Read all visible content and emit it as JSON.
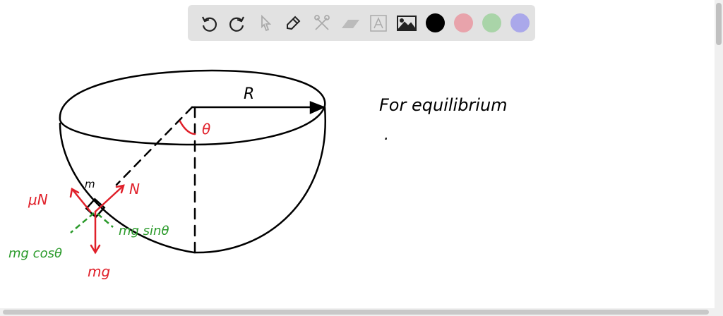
{
  "toolbar": {
    "tools": [
      "undo-icon",
      "redo-icon",
      "select-icon",
      "pen-icon",
      "tools-icon",
      "eraser-icon",
      "text-icon",
      "image-icon"
    ],
    "colors": [
      "#000000",
      "#e8a3ab",
      "#a9d4a8",
      "#aaa8ea"
    ]
  },
  "drawing": {
    "labels": {
      "radius": "R",
      "angle": "θ",
      "mass": "m",
      "normal": "N",
      "friction": "μN",
      "weight": "mg",
      "sin_component": "mg sinθ",
      "cos_component": "mg cosθ",
      "note": "For equilibrium",
      "note_dot": "."
    },
    "colors": {
      "ink": "#000000",
      "red": "#e0202a",
      "green": "#2a9a2a"
    }
  }
}
